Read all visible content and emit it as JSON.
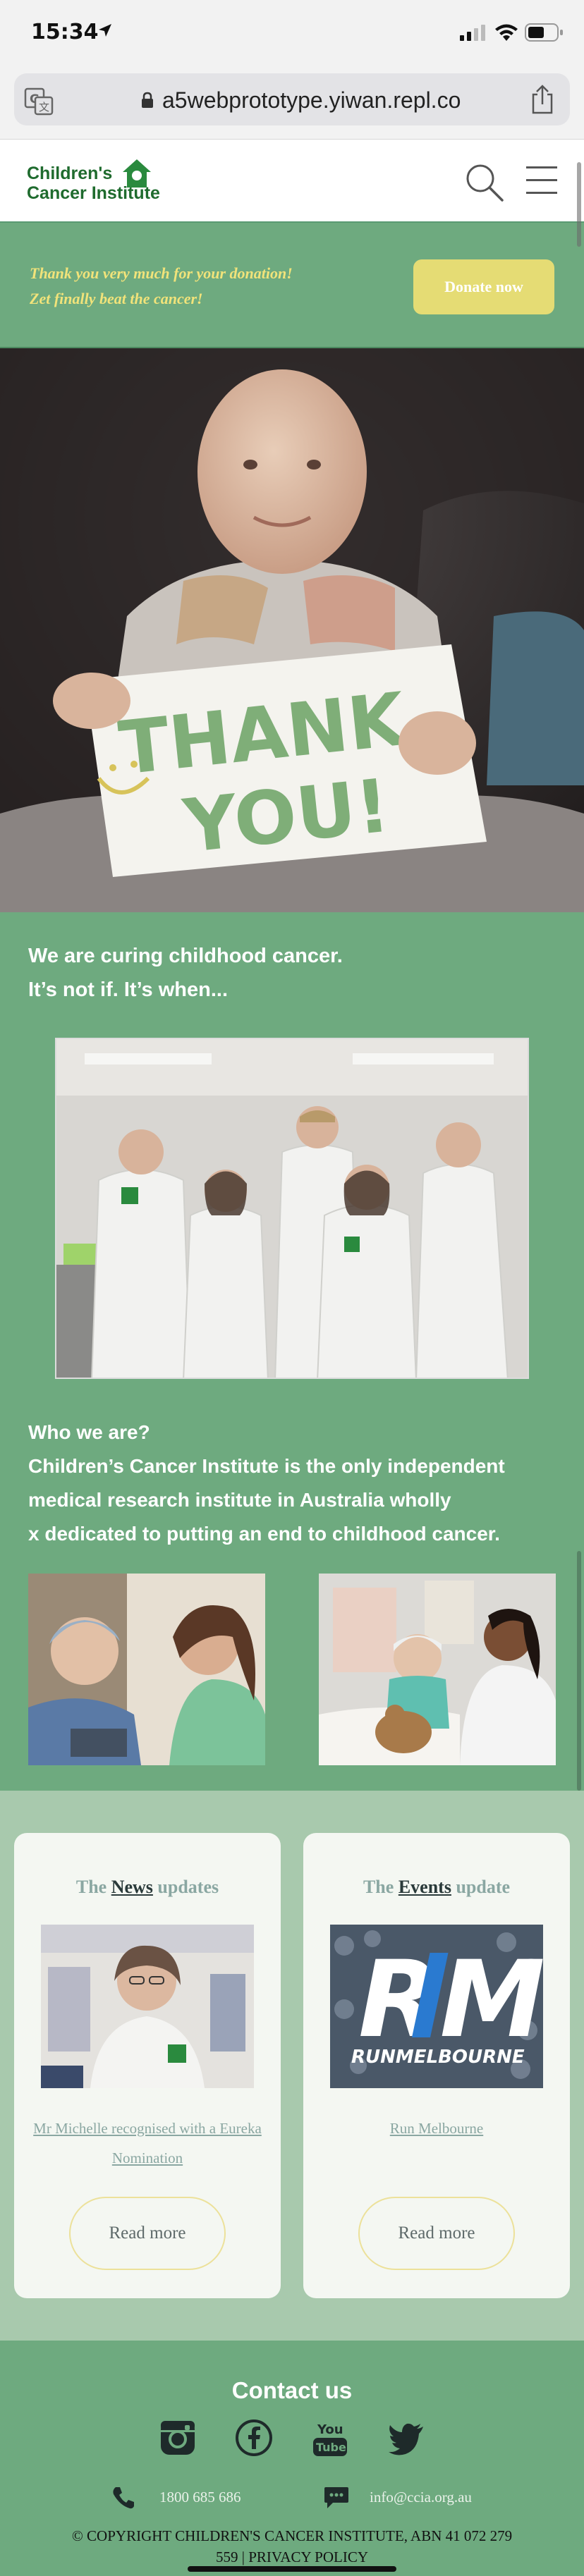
{
  "status_bar": {
    "time": "15:34"
  },
  "browser": {
    "url": "a5webprototype.yiwan.repl.co"
  },
  "header": {
    "logo_line1": "Children's",
    "logo_line2": "Cancer Institute"
  },
  "donate_banner": {
    "thanks_line1": "Thank you very much for your donation!",
    "thanks_line2": "Zet finally beat the cancer!",
    "button_label": "Donate now"
  },
  "hero": {
    "sign_text_line1": "THANK",
    "sign_text_line2": "YOU!"
  },
  "mission": {
    "line1": "We are curing childhood cancer.",
    "line2": "It’s not if. It’s when...",
    "who_heading": "Who we are?",
    "who_line1": "Children’s Cancer Institute is the only independent",
    "who_line2": "medical research institute in Australia wholly",
    "who_line3": "x dedicated to putting an end to childhood cancer."
  },
  "cards": {
    "news": {
      "title_prefix": "The ",
      "title_link": "News",
      "title_suffix": " updates",
      "link_line1": "Mr Michelle recognised with a Eureka",
      "link_line2": "Nomination",
      "read_more": "Read more"
    },
    "events": {
      "title_prefix": "The ",
      "title_link": "Events",
      "title_suffix": " update",
      "image_text_large": "RM",
      "image_text_small": "RUNMELBOURNE",
      "link_line1": "Run Melbourne",
      "read_more": "Read more"
    }
  },
  "contact": {
    "title": "Contact us",
    "youtube_line1": "You",
    "youtube_line2": "Tube",
    "phone": "1800 685 686",
    "email": "info@ccia.org.au",
    "copyright_line1": "© COPYRIGHT CHILDREN'S CANCER INSTITUTE, ABN 41 072 279",
    "copyright_line2": "559 | PRIVACY POLICY"
  },
  "colors": {
    "brand_green": "#6eaa7f",
    "logo_green": "#1f6b2e",
    "donate_yellow": "#e5dc74",
    "banner_text_yellow": "#f1e37a",
    "card_bg": "#f4f7f2",
    "cards_section_bg": "#a8c9ad"
  },
  "icons": {
    "status": [
      "location-arrow-icon",
      "signal-icon",
      "wifi-icon",
      "battery-icon"
    ],
    "browser": [
      "translate-icon",
      "lock-icon",
      "share-icon"
    ],
    "header": [
      "search-icon",
      "hamburger-menu-icon"
    ],
    "social": [
      "instagram-icon",
      "facebook-icon",
      "youtube-icon",
      "twitter-icon"
    ],
    "contact": [
      "phone-icon",
      "chat-icon"
    ]
  }
}
